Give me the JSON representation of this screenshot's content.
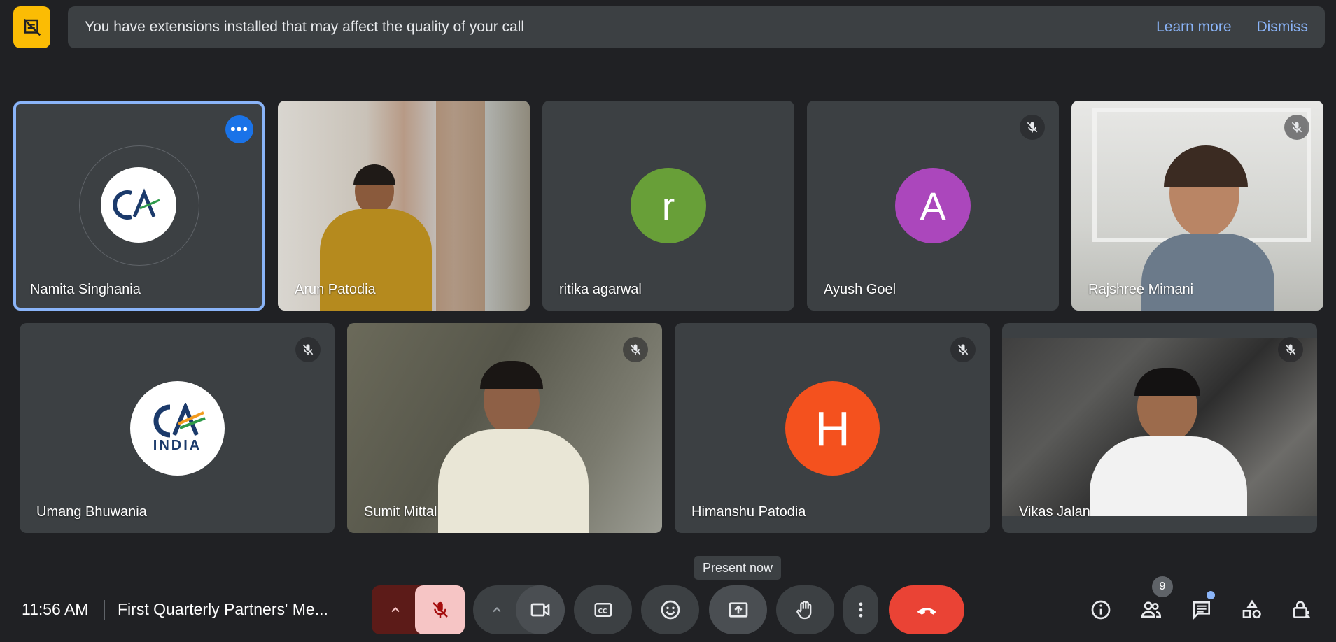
{
  "banner": {
    "icon": "extensions-warning-icon",
    "message": "You have extensions installed that may affect the quality of your call",
    "learn_more": "Learn more",
    "dismiss": "Dismiss"
  },
  "participants": [
    {
      "name": "Namita Singhania",
      "avatar": "CA logo",
      "active": true
    },
    {
      "name": "Arun Patodia",
      "video": true
    },
    {
      "name": "ritika agarwal",
      "initial": "r",
      "color": "#689f38"
    },
    {
      "name": "Ayush Goel",
      "initial": "A",
      "color": "#ab47bc",
      "muted": true
    },
    {
      "name": "Rajshree Mimani",
      "video": true,
      "muted": true
    },
    {
      "name": "Umang Bhuwania",
      "avatar_text": "INDIA",
      "muted": true
    },
    {
      "name": "Sumit Mittal",
      "video": true,
      "muted": true
    },
    {
      "name": "Himanshu Patodia",
      "initial": "H",
      "color": "#f4511e",
      "muted": true
    },
    {
      "name": "Vikas Jalan",
      "video": true,
      "muted": true
    }
  ],
  "bottom_bar": {
    "time": "11:56 AM",
    "meeting_title": "First Quarterly Partners' Me...",
    "tooltip": "Present now",
    "people_count": "9"
  },
  "colors": {
    "accent": "#8ab4f8",
    "end_call": "#ea4335",
    "mic_off_bg": "#f6c5c5",
    "mic_group_bg": "#5c1b18"
  }
}
